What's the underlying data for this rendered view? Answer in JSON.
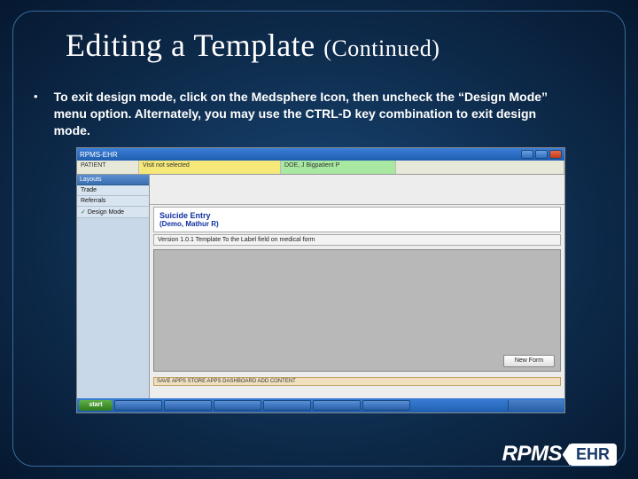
{
  "slide": {
    "title_main": "Editing a Template",
    "title_cont": "(Continued)",
    "bullet": "To exit design mode, click on the Medsphere Icon, then uncheck the “Design Mode” menu option.  Alternately, you may use the CTRL-D key combination to exit design mode."
  },
  "screenshot": {
    "window_title": "RPMS-EHR",
    "header": {
      "cell1": "PATIENT",
      "cell2": "Visit not selected",
      "cell3": "DOE, J  Bigpatient P"
    },
    "sidebar": {
      "heading": "Layouts",
      "items": [
        "Trade",
        "Referrals"
      ],
      "checked": "Design Mode"
    },
    "panel": {
      "title": "Suicide Entry",
      "subtitle": "(Demo, Mathur R)"
    },
    "panel2_text": "Version 1.0.1  Template     To the Label field on medical form",
    "new_form_btn": "New Form",
    "ribbon": "SAVE APPS   STORE APPS    DASHBOARD    ADD CONTENT",
    "start": "start"
  },
  "logos": {
    "rpms": "RPMS",
    "ehr": "EHR"
  }
}
